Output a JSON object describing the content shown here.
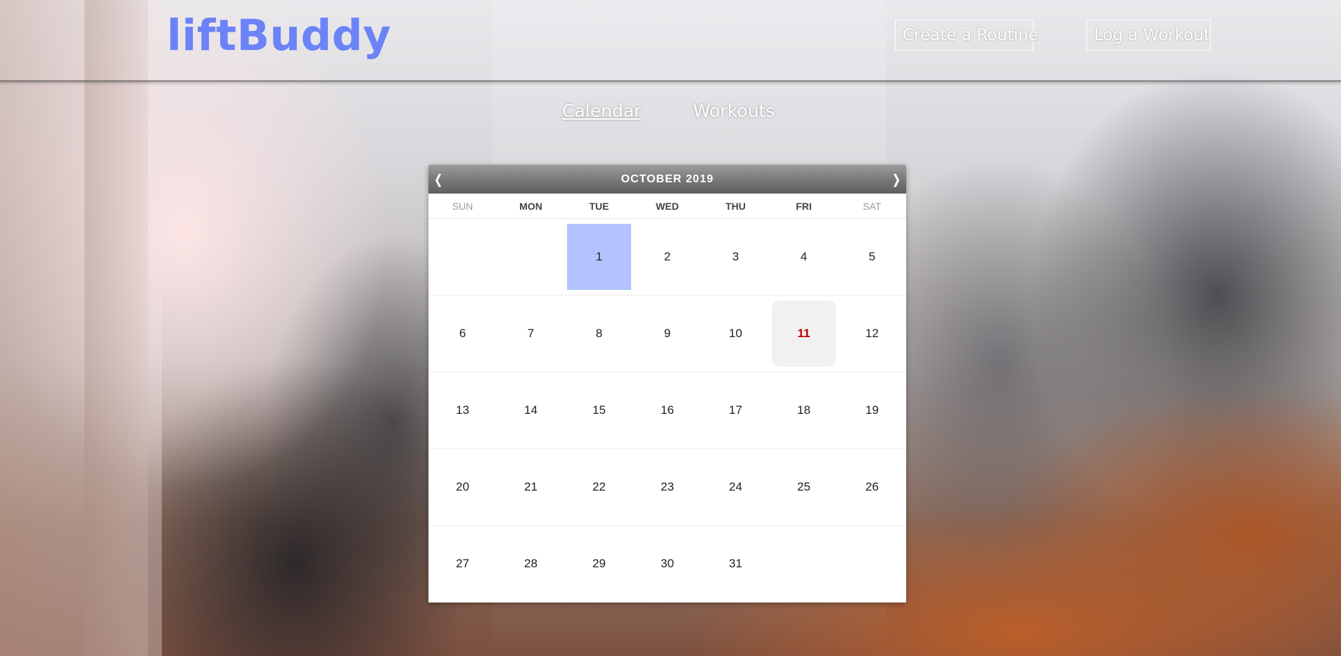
{
  "app": {
    "logo": "liftBuddy"
  },
  "header": {
    "create_routine_label": "Create a Routine",
    "log_workout_label": "Log a Workout"
  },
  "subnav": {
    "calendar_label": "Calendar",
    "workouts_label": "Workouts",
    "active": "Calendar"
  },
  "calendar": {
    "title": "OCTOBER 2019",
    "prev_label": "❬",
    "next_label": "❭",
    "weekdays": [
      "SUN",
      "MON",
      "TUE",
      "WED",
      "THU",
      "FRI",
      "SAT"
    ],
    "weeks": [
      [
        "",
        "",
        "1",
        "2",
        "3",
        "4",
        "5"
      ],
      [
        "6",
        "7",
        "8",
        "9",
        "10",
        "11",
        "12"
      ],
      [
        "13",
        "14",
        "15",
        "16",
        "17",
        "18",
        "19"
      ],
      [
        "20",
        "21",
        "22",
        "23",
        "24",
        "25",
        "26"
      ],
      [
        "27",
        "28",
        "29",
        "30",
        "31",
        "",
        ""
      ]
    ],
    "selected_day": "1",
    "today": "11",
    "colors": {
      "selected": "#b2c3ff",
      "today_bg": "#f1f1f1",
      "today_text": "#b80000",
      "logo": "#6c83f7"
    }
  }
}
